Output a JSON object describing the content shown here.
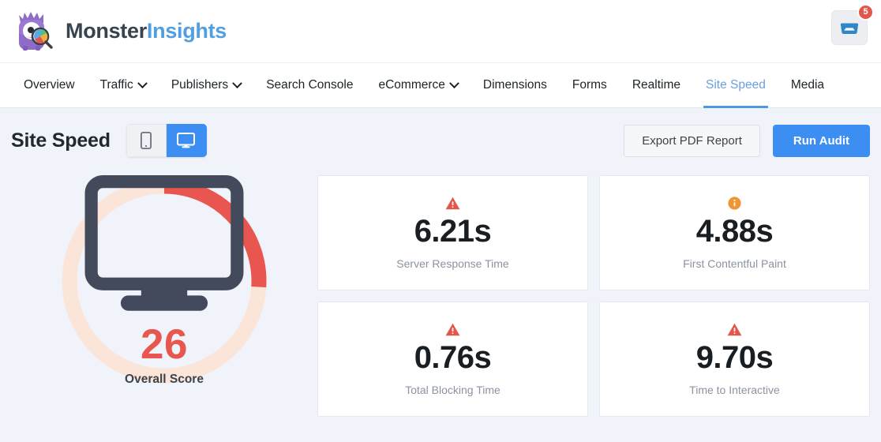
{
  "header": {
    "brand_first": "Monster",
    "brand_second": "Insights",
    "logo_icon": "monsterinsights-mascot-icon",
    "inbox_icon": "inbox-tray-icon",
    "inbox_badge_count": "5"
  },
  "nav": {
    "items": [
      {
        "label": "Overview",
        "has_caret": false,
        "active": false
      },
      {
        "label": "Traffic",
        "has_caret": true,
        "active": false
      },
      {
        "label": "Publishers",
        "has_caret": true,
        "active": false
      },
      {
        "label": "Search Console",
        "has_caret": false,
        "active": false
      },
      {
        "label": "eCommerce",
        "has_caret": true,
        "active": false
      },
      {
        "label": "Dimensions",
        "has_caret": false,
        "active": false
      },
      {
        "label": "Forms",
        "has_caret": false,
        "active": false
      },
      {
        "label": "Realtime",
        "has_caret": false,
        "active": false
      },
      {
        "label": "Site Speed",
        "has_caret": false,
        "active": true
      },
      {
        "label": "Media",
        "has_caret": false,
        "active": false
      }
    ]
  },
  "page_head": {
    "title": "Site Speed",
    "device_toggle": {
      "mobile_icon": "mobile-phone-icon",
      "desktop_icon": "desktop-monitor-icon",
      "selected": "desktop"
    },
    "export_label": "Export PDF Report",
    "run_audit_label": "Run Audit"
  },
  "score": {
    "value": "26",
    "label": "Overall Score",
    "percent": 26,
    "device_icon": "desktop-monitor-icon",
    "arc_color": "#e8564f",
    "track_color": "#fbe5d8"
  },
  "metrics": [
    {
      "value": "6.21s",
      "label": "Server Response Time",
      "status": "warning",
      "icon": "warning-triangle-icon",
      "color": "#e2574c"
    },
    {
      "value": "4.88s",
      "label": "First Contentful Paint",
      "status": "info",
      "icon": "info-circle-icon",
      "color": "#ef9634"
    },
    {
      "value": "0.76s",
      "label": "Total Blocking Time",
      "status": "warning",
      "icon": "warning-triangle-icon",
      "color": "#e2574c"
    },
    {
      "value": "9.70s",
      "label": "Time to Interactive",
      "status": "warning",
      "icon": "warning-triangle-icon",
      "color": "#e2574c"
    }
  ],
  "colors": {
    "page_background": "#f1f3fb",
    "accent_blue": "#3d8ef2",
    "brand_blue": "#509fe2",
    "danger_red": "#e2574c",
    "warn_orange": "#ef9634"
  }
}
